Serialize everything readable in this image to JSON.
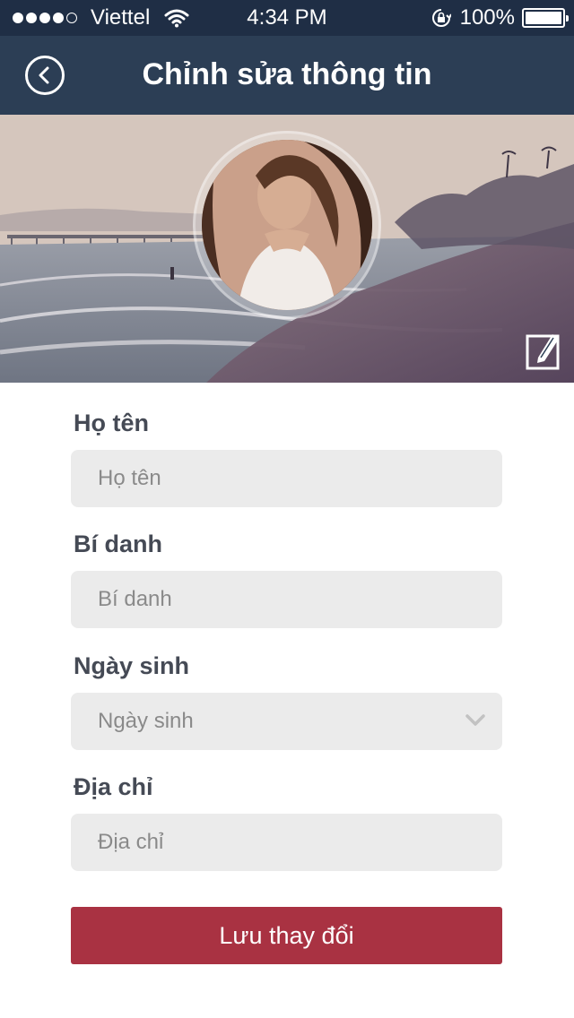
{
  "status_bar": {
    "carrier": "Viettel",
    "time": "4:34 PM",
    "battery": "100%",
    "signal_bars_filled": 4,
    "signal_bars_total": 5
  },
  "nav": {
    "title": "Chỉnh sửa thông tin",
    "back_icon": "chevron-left-circle-icon"
  },
  "cover": {
    "edit_icon": "edit-square-icon"
  },
  "form": {
    "full_name": {
      "label": "Họ tên",
      "placeholder": "Họ tên",
      "value": ""
    },
    "nickname": {
      "label": "Bí danh",
      "placeholder": "Bí danh",
      "value": ""
    },
    "birthday": {
      "label": "Ngày sinh",
      "placeholder": "Ngày sinh",
      "icon": "chevron-down-icon"
    },
    "address": {
      "label": "Địa chỉ",
      "placeholder": "Địa chỉ",
      "value": ""
    },
    "save_label": "Lưu thay đổi"
  },
  "colors": {
    "status_bar_bg": "#1f2e45",
    "nav_bg": "#2c3e55",
    "field_bg": "#ebebeb",
    "primary_button": "#a93242",
    "label_text": "#454a55",
    "placeholder_text": "#8a8a8a"
  }
}
